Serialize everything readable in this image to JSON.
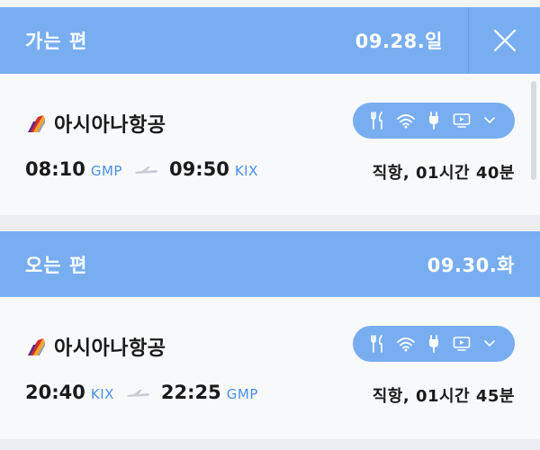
{
  "outbound": {
    "header_title": "가는 편",
    "header_date": "09.28.일",
    "airline": "아시아나항공",
    "departure_time": "08:10",
    "departure_code": "GMP",
    "arrival_time": "09:50",
    "arrival_code": "KIX",
    "duration": "직항, 01시간 40분"
  },
  "return": {
    "header_title": "오는 편",
    "header_date": "09.30.화",
    "airline": "아시아나항공",
    "departure_time": "20:40",
    "departure_code": "KIX",
    "arrival_time": "22:25",
    "arrival_code": "GMP",
    "duration": "직항, 01시간 45분"
  },
  "amenities": [
    "meal-icon",
    "wifi-icon",
    "power-icon",
    "tv-icon",
    "chevron-down-icon"
  ],
  "colors": {
    "accent": "#78aef0",
    "code_blue": "#4a8fe7",
    "text": "#1a1a1a"
  }
}
